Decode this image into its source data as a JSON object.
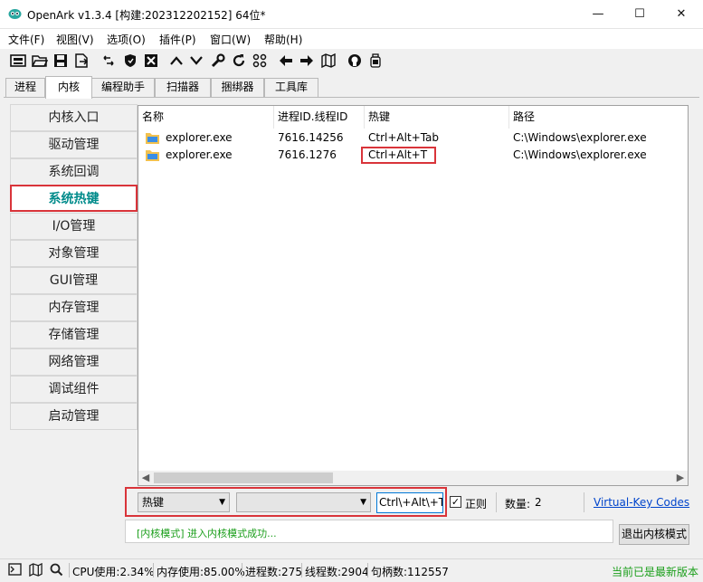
{
  "window": {
    "title": "OpenArk v1.3.4 [构建:202312202152]  64位*",
    "controls": {
      "minimize": "—",
      "maximize": "☐",
      "close": "✕"
    }
  },
  "menu": [
    {
      "label": "文件(F)"
    },
    {
      "label": "视图(V)"
    },
    {
      "label": "选项(O)"
    },
    {
      "label": "插件(P)"
    },
    {
      "label": "窗口(W)"
    },
    {
      "label": "帮助(H)"
    }
  ],
  "toolbar": {
    "icons": [
      "console-icon",
      "open-folder-icon",
      "save-icon",
      "export-icon",
      "link-icon",
      "shield-icon",
      "block-icon",
      "up-icon",
      "down-icon",
      "wrench-icon",
      "refresh-icon",
      "grid-icon",
      "back-icon",
      "forward-icon",
      "map-icon",
      "github-icon",
      "bottle-icon"
    ]
  },
  "tabs": [
    {
      "label": "进程",
      "active": false
    },
    {
      "label": "内核",
      "active": true
    },
    {
      "label": "编程助手",
      "active": false
    },
    {
      "label": "扫描器",
      "active": false
    },
    {
      "label": "捆绑器",
      "active": false
    },
    {
      "label": "工具库",
      "active": false
    }
  ],
  "sidebar": {
    "items": [
      {
        "label": "内核入口"
      },
      {
        "label": "驱动管理"
      },
      {
        "label": "系统回调"
      },
      {
        "label": "系统热键",
        "active": true
      },
      {
        "label": "I/O管理"
      },
      {
        "label": "对象管理"
      },
      {
        "label": "GUI管理"
      },
      {
        "label": "内存管理"
      },
      {
        "label": "存储管理"
      },
      {
        "label": "网络管理"
      },
      {
        "label": "调试组件"
      },
      {
        "label": "启动管理"
      }
    ]
  },
  "table": {
    "columns": [
      "名称",
      "进程ID.线程ID",
      "热键",
      "路径"
    ],
    "rows": [
      {
        "name": "explorer.exe",
        "pid_tid": "7616.14256",
        "hotkey": "Ctrl+Alt+Tab",
        "path": "C:\\Windows\\explorer.exe"
      },
      {
        "name": "explorer.exe",
        "pid_tid": "7616.1276",
        "hotkey": "Ctrl+Alt+T",
        "path": "C:\\Windows\\explorer.exe"
      }
    ]
  },
  "filter": {
    "field_combo": "热键",
    "second_combo": "",
    "pattern": "Ctrl\\+Alt\\+T",
    "regex_label": "正则",
    "regex_checked": true,
    "count_label": "数量:",
    "count_value": "2",
    "vk_link": "Virtual-Key Codes"
  },
  "log": {
    "message": "[内核模式] 进入内核模式成功..."
  },
  "exit_button": {
    "label": "退出内核模式"
  },
  "statusbar": {
    "cpu": "CPU使用:2.34%",
    "memory": "内存使用:85.00%",
    "processes": "进程数:275",
    "threads": "线程数:2904",
    "handles": "句柄数:112557",
    "update_status": "当前已是最新版本"
  },
  "colors": {
    "accent": "#008b8b",
    "highlight": "#d9343a",
    "link": "#0044cc",
    "log_green": "#1a9e1a",
    "update_green": "#1a9e1a"
  }
}
